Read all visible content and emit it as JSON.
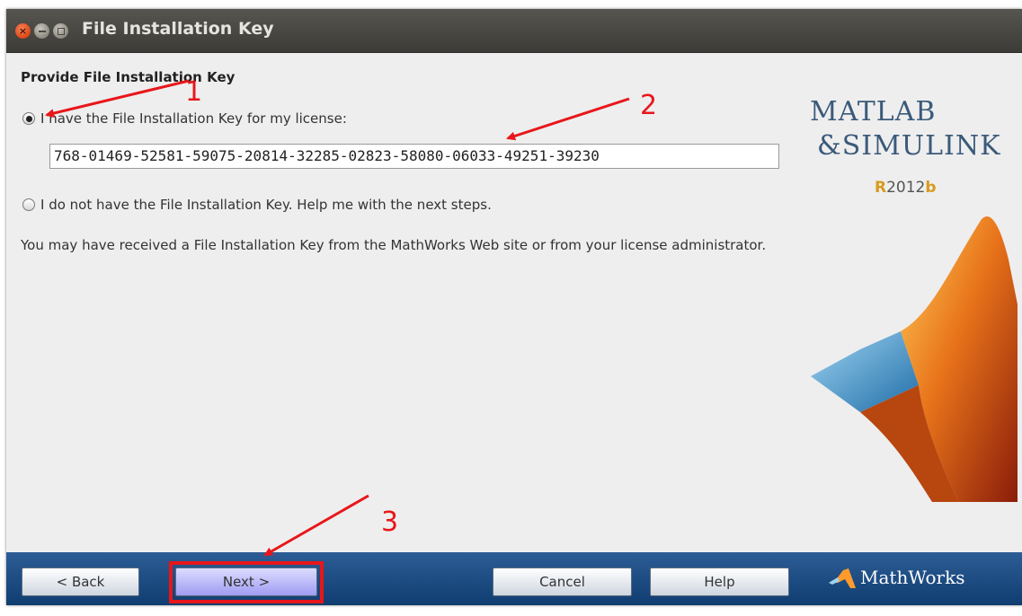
{
  "window": {
    "title": "File Installation Key"
  },
  "content": {
    "section_title": "Provide File Installation Key",
    "option_have_key": "I have the File Installation Key for my license:",
    "installation_key": "768-01469-52581-59075-20814-32285-02823-58080-06033-49251-39230",
    "option_no_key": "I do not have the File Installation Key.  Help me with the next steps.",
    "description": "You may have received a File Installation Key from the MathWorks Web site or from your license administrator.",
    "selected_option": "have_key"
  },
  "branding": {
    "logo_line1": "MATLAB",
    "logo_line2": "&SIMULINK",
    "release_r": "R",
    "release_year": "2012",
    "release_b": "b",
    "footer_logo": "MathWorks"
  },
  "buttons": {
    "back": "< Back",
    "next": "Next >",
    "cancel": "Cancel",
    "help": "Help"
  },
  "annotations": {
    "label_1": "1",
    "label_2": "2",
    "label_3": "3",
    "color": "#e8161a"
  },
  "icons": {
    "close": "close-icon",
    "minimize": "minimize-icon",
    "maximize": "maximize-icon",
    "membrane": "matlab-membrane-icon",
    "mathworks": "mathworks-logo-icon"
  }
}
